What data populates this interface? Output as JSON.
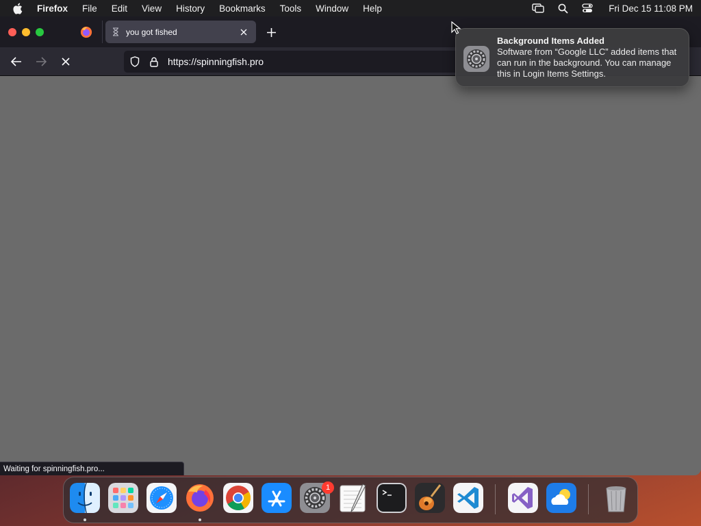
{
  "menubar": {
    "app_name": "Firefox",
    "items": [
      "File",
      "Edit",
      "View",
      "History",
      "Bookmarks",
      "Tools",
      "Window",
      "Help"
    ],
    "clock": "Fri Dec 15  11:08 PM"
  },
  "browser": {
    "tab": {
      "title": "you got fished",
      "loading": true
    },
    "url": "https://spinningfish.pro",
    "status_text": "Waiting for spinningfish.pro..."
  },
  "notification": {
    "title": "Background Items Added",
    "body": "Software from “Google LLC” added items that can run in the background. You can manage this in Login Items Settings."
  },
  "dock": {
    "apps": [
      "Finder",
      "Launchpad",
      "Safari",
      "Firefox",
      "Google Chrome",
      "App Store",
      "System Settings",
      "TextEdit",
      "Terminal",
      "GarageBand",
      "Visual Studio Code",
      "Visual Studio",
      "Weather",
      "Trash"
    ],
    "system_settings_badge": "1"
  },
  "colors": {
    "tab_bar": "#1c1b22",
    "nav_bar": "#2b2a33",
    "content": "#6b6b6b",
    "close": "#ff5f57",
    "minimize": "#febc2e",
    "maximize": "#28c840"
  }
}
